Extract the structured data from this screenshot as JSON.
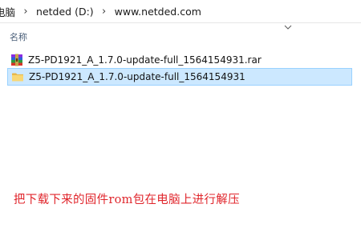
{
  "address_bar": {
    "crumbs": [
      "电脑",
      "netded (D:)",
      "www.netded.com"
    ],
    "separator": "›"
  },
  "column_header": {
    "name_label": "名称",
    "sort_icon": "chevron-down-icon"
  },
  "files": [
    {
      "name": "Z5-PD1921_A_1.7.0-update-full_1564154931.rar",
      "icon": "rar-archive-icon",
      "selected": false
    },
    {
      "name": "Z5-PD1921_A_1.7.0-update-full_1564154931",
      "icon": "folder-icon",
      "selected": true
    }
  ],
  "annotation": {
    "text": "把下载下来的固件rom包在电脑上进行解压",
    "color": "#e0262c"
  },
  "colors": {
    "selection_bg": "#cce8ff",
    "selection_border": "#99d1ff",
    "header_text": "#4c607a"
  }
}
